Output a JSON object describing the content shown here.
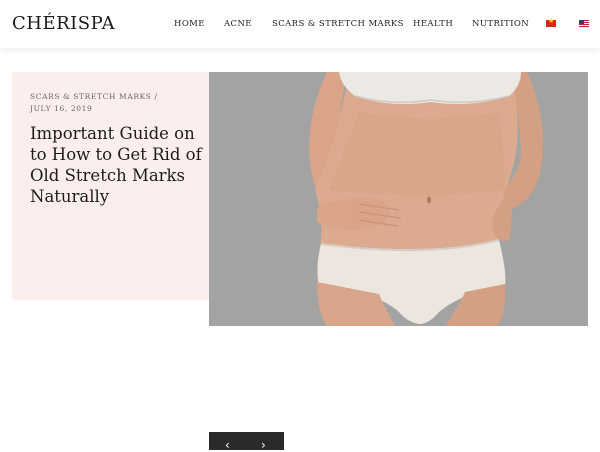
{
  "header": {
    "logo": "CHÉRISPA",
    "nav": [
      {
        "label": "HOME"
      },
      {
        "label": "ACNE"
      },
      {
        "label": "SCARS & STRETCH MARKS"
      },
      {
        "label": "HEALTH"
      },
      {
        "label": "NUTRITION"
      }
    ],
    "languages": [
      {
        "icon": "vietnam-flag-icon",
        "color": "#da251d"
      },
      {
        "icon": "us-flag-icon",
        "color": "#3c3b6e"
      }
    ]
  },
  "post": {
    "category": "SCARS & STRETCH MARKS",
    "separator": "/",
    "date": "JULY 16, 2019",
    "title": "Important Guide on to How to Get Rid of Old Stretch Marks Naturally",
    "card_color": "#fdeeee"
  },
  "slider": {
    "prev_icon": "chevron-left-icon",
    "next_icon": "chevron-right-icon",
    "prev": "‹",
    "next": "›"
  }
}
